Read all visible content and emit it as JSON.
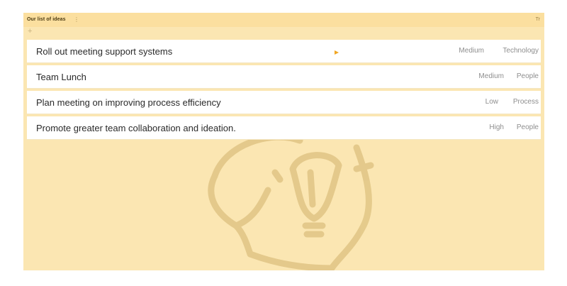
{
  "board": {
    "title": "Our list of ideas",
    "menu_glyph": "⋮",
    "text_format_label": "Tr",
    "add_glyph": "+"
  },
  "ideas": [
    {
      "title": "Roll out meeting support systems",
      "priority": "Medium",
      "category": "Technology"
    },
    {
      "title": "Team Lunch",
      "priority": "Medium",
      "category": "People"
    },
    {
      "title": "Plan meeting on improving process efficiency",
      "priority": "Low",
      "category": "Process"
    },
    {
      "title": "Promote greater team collaboration and ideation.",
      "priority": "High",
      "category": "People"
    }
  ],
  "icons": {
    "play": "play-icon",
    "watermark": "lightbulb-head-icon"
  },
  "colors": {
    "board_background": "#fbe6b2",
    "header_background": "#fbdf9f",
    "accent": "#f0a623"
  }
}
